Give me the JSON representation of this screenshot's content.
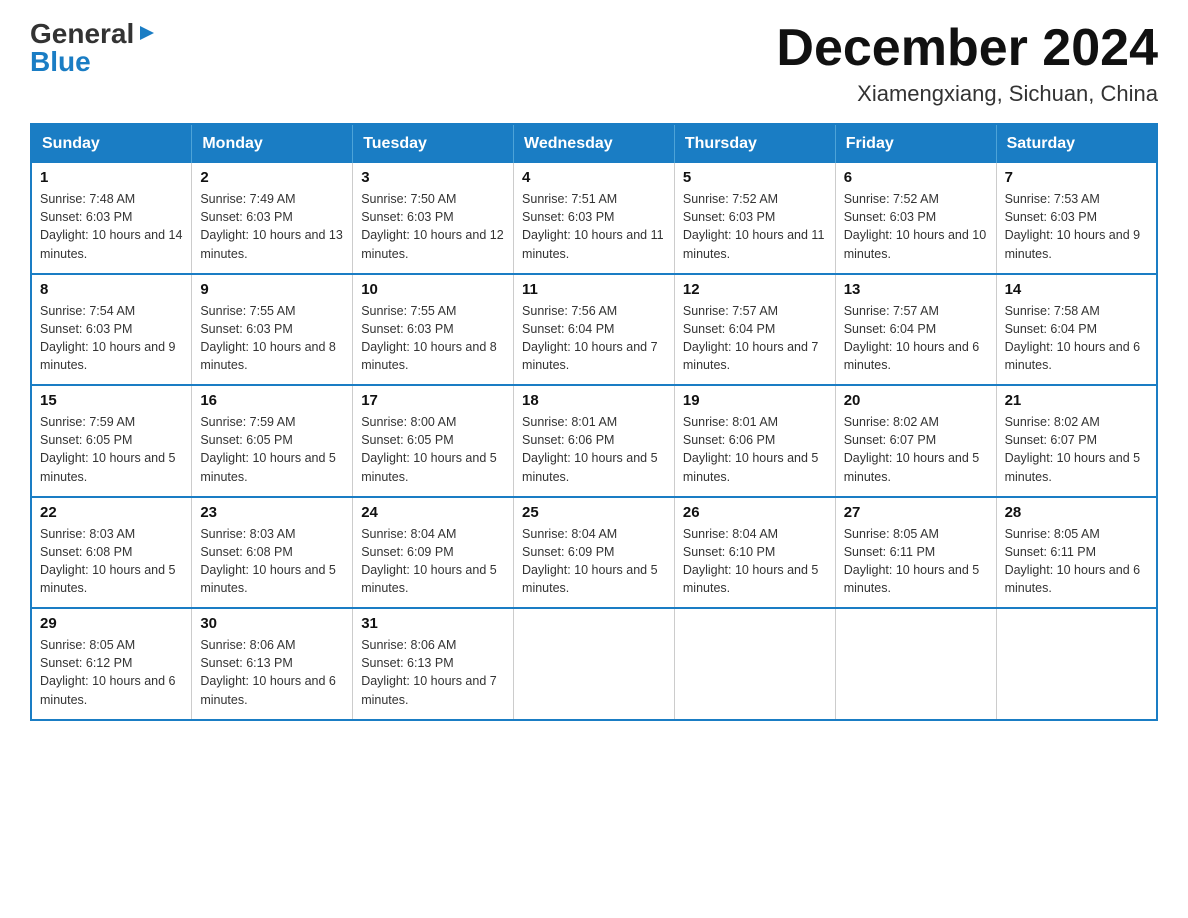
{
  "header": {
    "logo": {
      "general": "General",
      "arrow": "▶",
      "blue": "Blue"
    },
    "title": "December 2024",
    "location": "Xiamengxiang, Sichuan, China"
  },
  "calendar": {
    "days_of_week": [
      "Sunday",
      "Monday",
      "Tuesday",
      "Wednesday",
      "Thursday",
      "Friday",
      "Saturday"
    ],
    "weeks": [
      [
        {
          "day": "1",
          "sunrise": "7:48 AM",
          "sunset": "6:03 PM",
          "daylight": "10 hours and 14 minutes."
        },
        {
          "day": "2",
          "sunrise": "7:49 AM",
          "sunset": "6:03 PM",
          "daylight": "10 hours and 13 minutes."
        },
        {
          "day": "3",
          "sunrise": "7:50 AM",
          "sunset": "6:03 PM",
          "daylight": "10 hours and 12 minutes."
        },
        {
          "day": "4",
          "sunrise": "7:51 AM",
          "sunset": "6:03 PM",
          "daylight": "10 hours and 11 minutes."
        },
        {
          "day": "5",
          "sunrise": "7:52 AM",
          "sunset": "6:03 PM",
          "daylight": "10 hours and 11 minutes."
        },
        {
          "day": "6",
          "sunrise": "7:52 AM",
          "sunset": "6:03 PM",
          "daylight": "10 hours and 10 minutes."
        },
        {
          "day": "7",
          "sunrise": "7:53 AM",
          "sunset": "6:03 PM",
          "daylight": "10 hours and 9 minutes."
        }
      ],
      [
        {
          "day": "8",
          "sunrise": "7:54 AM",
          "sunset": "6:03 PM",
          "daylight": "10 hours and 9 minutes."
        },
        {
          "day": "9",
          "sunrise": "7:55 AM",
          "sunset": "6:03 PM",
          "daylight": "10 hours and 8 minutes."
        },
        {
          "day": "10",
          "sunrise": "7:55 AM",
          "sunset": "6:03 PM",
          "daylight": "10 hours and 8 minutes."
        },
        {
          "day": "11",
          "sunrise": "7:56 AM",
          "sunset": "6:04 PM",
          "daylight": "10 hours and 7 minutes."
        },
        {
          "day": "12",
          "sunrise": "7:57 AM",
          "sunset": "6:04 PM",
          "daylight": "10 hours and 7 minutes."
        },
        {
          "day": "13",
          "sunrise": "7:57 AM",
          "sunset": "6:04 PM",
          "daylight": "10 hours and 6 minutes."
        },
        {
          "day": "14",
          "sunrise": "7:58 AM",
          "sunset": "6:04 PM",
          "daylight": "10 hours and 6 minutes."
        }
      ],
      [
        {
          "day": "15",
          "sunrise": "7:59 AM",
          "sunset": "6:05 PM",
          "daylight": "10 hours and 5 minutes."
        },
        {
          "day": "16",
          "sunrise": "7:59 AM",
          "sunset": "6:05 PM",
          "daylight": "10 hours and 5 minutes."
        },
        {
          "day": "17",
          "sunrise": "8:00 AM",
          "sunset": "6:05 PM",
          "daylight": "10 hours and 5 minutes."
        },
        {
          "day": "18",
          "sunrise": "8:01 AM",
          "sunset": "6:06 PM",
          "daylight": "10 hours and 5 minutes."
        },
        {
          "day": "19",
          "sunrise": "8:01 AM",
          "sunset": "6:06 PM",
          "daylight": "10 hours and 5 minutes."
        },
        {
          "day": "20",
          "sunrise": "8:02 AM",
          "sunset": "6:07 PM",
          "daylight": "10 hours and 5 minutes."
        },
        {
          "day": "21",
          "sunrise": "8:02 AM",
          "sunset": "6:07 PM",
          "daylight": "10 hours and 5 minutes."
        }
      ],
      [
        {
          "day": "22",
          "sunrise": "8:03 AM",
          "sunset": "6:08 PM",
          "daylight": "10 hours and 5 minutes."
        },
        {
          "day": "23",
          "sunrise": "8:03 AM",
          "sunset": "6:08 PM",
          "daylight": "10 hours and 5 minutes."
        },
        {
          "day": "24",
          "sunrise": "8:04 AM",
          "sunset": "6:09 PM",
          "daylight": "10 hours and 5 minutes."
        },
        {
          "day": "25",
          "sunrise": "8:04 AM",
          "sunset": "6:09 PM",
          "daylight": "10 hours and 5 minutes."
        },
        {
          "day": "26",
          "sunrise": "8:04 AM",
          "sunset": "6:10 PM",
          "daylight": "10 hours and 5 minutes."
        },
        {
          "day": "27",
          "sunrise": "8:05 AM",
          "sunset": "6:11 PM",
          "daylight": "10 hours and 5 minutes."
        },
        {
          "day": "28",
          "sunrise": "8:05 AM",
          "sunset": "6:11 PM",
          "daylight": "10 hours and 6 minutes."
        }
      ],
      [
        {
          "day": "29",
          "sunrise": "8:05 AM",
          "sunset": "6:12 PM",
          "daylight": "10 hours and 6 minutes."
        },
        {
          "day": "30",
          "sunrise": "8:06 AM",
          "sunset": "6:13 PM",
          "daylight": "10 hours and 6 minutes."
        },
        {
          "day": "31",
          "sunrise": "8:06 AM",
          "sunset": "6:13 PM",
          "daylight": "10 hours and 7 minutes."
        },
        null,
        null,
        null,
        null
      ]
    ],
    "labels": {
      "sunrise": "Sunrise:",
      "sunset": "Sunset:",
      "daylight": "Daylight:"
    }
  }
}
